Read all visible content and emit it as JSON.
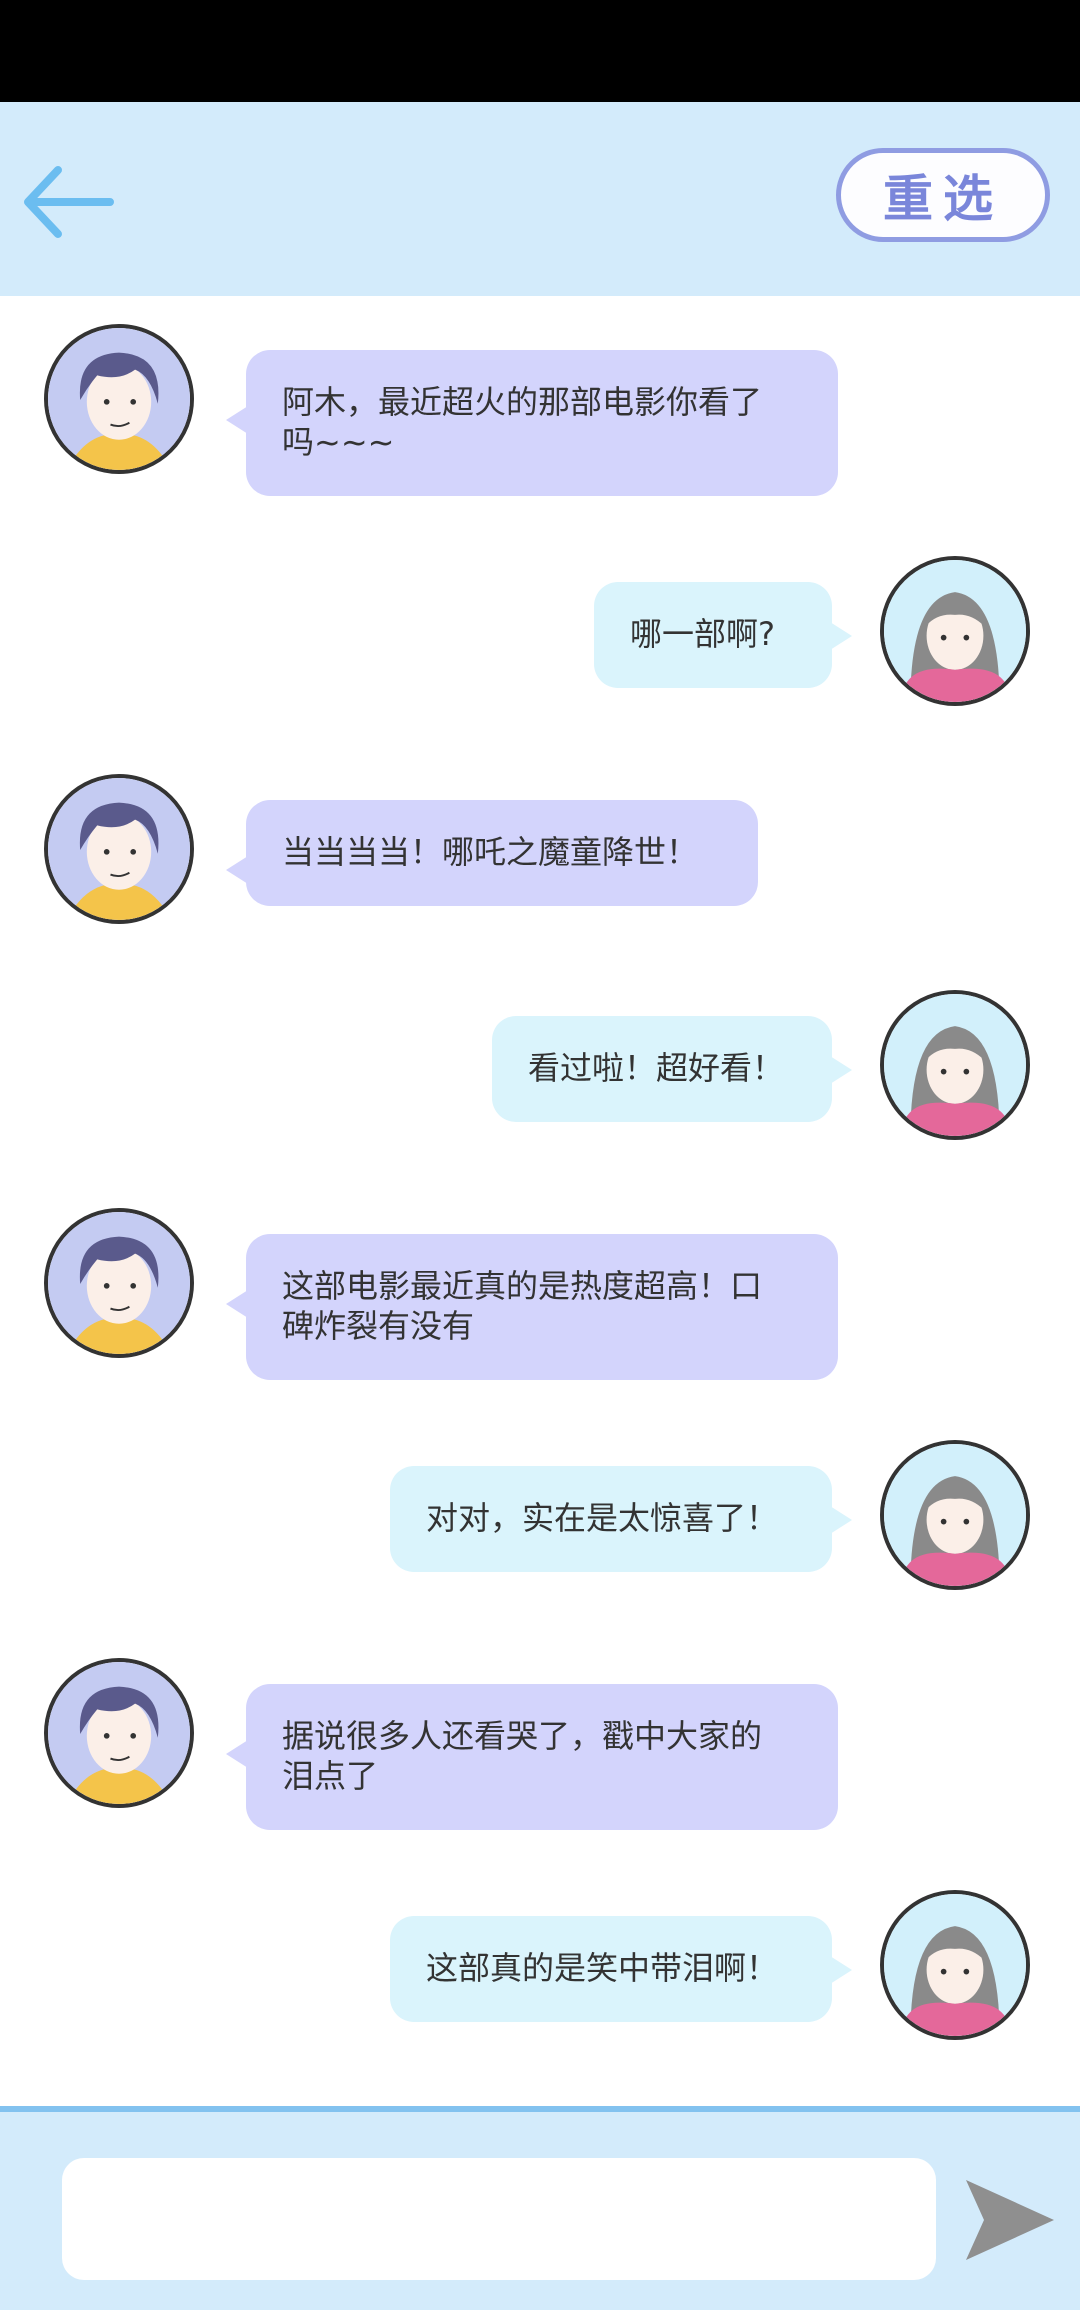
{
  "header": {
    "back_icon": "arrow-left-icon",
    "reselect_label": "重选"
  },
  "messages": [
    {
      "side": "left",
      "avatar": "boy-avatar",
      "text_lines": [
        "阿木，最近超火的那部电影你看了",
        "吗~~~"
      ]
    },
    {
      "side": "right",
      "avatar": "girl-avatar",
      "text_lines": [
        "哪一部啊?"
      ]
    },
    {
      "side": "left",
      "avatar": "boy-avatar",
      "text_lines": [
        "当当当当！哪吒之魔童降世！"
      ]
    },
    {
      "side": "right",
      "avatar": "girl-avatar",
      "text_lines": [
        "看过啦！超好看！"
      ]
    },
    {
      "side": "left",
      "avatar": "boy-avatar",
      "text_lines": [
        "这部电影最近真的是热度超高！口",
        "碑炸裂有没有"
      ]
    },
    {
      "side": "right",
      "avatar": "girl-avatar",
      "text_lines": [
        "对对，实在是太惊喜了！"
      ]
    },
    {
      "side": "left",
      "avatar": "boy-avatar",
      "text_lines": [
        "据说很多人还看哭了，戳中大家的",
        "泪点了"
      ]
    },
    {
      "side": "right",
      "avatar": "girl-avatar",
      "text_lines": [
        "这部真的是笑中带泪啊！"
      ]
    }
  ],
  "composer": {
    "input_value": "",
    "send_icon": "send-arrow-icon"
  },
  "colors": {
    "header_bg": "#d3ebfb",
    "left_bubble": "#d3d4fc",
    "right_bubble": "#daf4fc",
    "accent": "#82c2ef"
  }
}
